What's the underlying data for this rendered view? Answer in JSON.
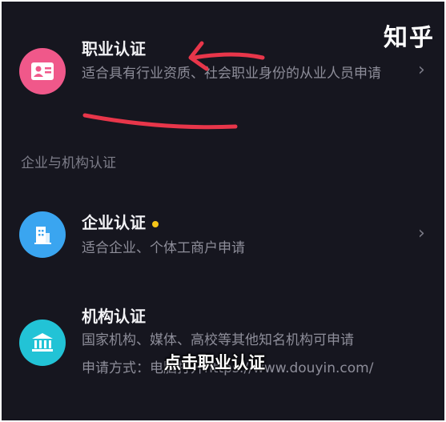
{
  "watermark": "知乎",
  "items": [
    {
      "title": "职业认证",
      "description": "适合具有行业资质、社会职业身份的从业人员申请",
      "icon": "id-card-icon",
      "color": "#f0588a"
    },
    {
      "title": "企业认证",
      "description": "适合企业、个体工商户申请",
      "icon": "building-icon",
      "color": "#3aa5f0"
    },
    {
      "title": "机构认证",
      "description": "国家机构、媒体、高校等其他知名机构可申请",
      "description_2": "申请方式：电脑打开https://www.douyin.com/",
      "icon": "institution-icon",
      "color": "#22c3d6"
    }
  ],
  "section_header": "企业与机构认证",
  "subtitle": "点击职业认证",
  "annotation_color": "#e8364a"
}
